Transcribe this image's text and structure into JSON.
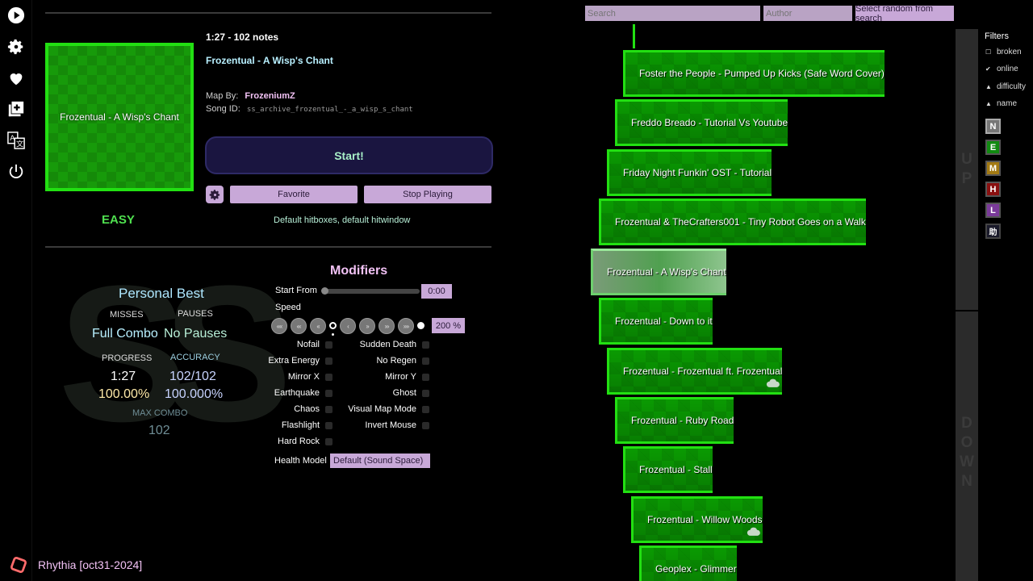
{
  "rail": {
    "icons": [
      "play-icon",
      "gear-icon",
      "heart-icon",
      "add-icon",
      "translate-icon",
      "power-icon"
    ]
  },
  "song": {
    "cover_text": "Frozentual - A Wisp's Chant",
    "length_notes": "1:27 - 102 notes",
    "title": "Frozentual - A Wisp's Chant",
    "map_by_label": "Map By:",
    "map_by": "FrozeniumZ",
    "song_id_label": "Song ID:",
    "song_id": "ss_archive_frozentual_-_a_wisp_s_chant",
    "difficulty": "EASY",
    "hitbox_text": "Default hitboxes, default hitwindow"
  },
  "actions": {
    "start": "Start!",
    "favorite": "Favorite",
    "stop_playing": "Stop Playing"
  },
  "personal_best": {
    "title": "Personal Best",
    "bg_letters": "SS",
    "misses_label": "MISSES",
    "misses": "Full Combo",
    "pauses_label": "PAUSES",
    "pauses": "No Pauses",
    "progress_label": "PROGRESS",
    "progress_time": "1:27",
    "progress_pct": "100.00%",
    "accuracy_label": "ACCURACY",
    "accuracy_hits": "102/102",
    "accuracy_pct": "100.000%",
    "max_combo_label": "MAX COMBO",
    "max_combo": "102"
  },
  "modifiers": {
    "title": "Modifiers",
    "start_from_label": "Start From",
    "start_from_value": "0:00",
    "speed_label": "Speed",
    "speed_value": "200 %",
    "speed_buttons": [
      "‹‹‹‹",
      "‹‹‹",
      "‹‹",
      "‹",
      "›",
      "››",
      "›››",
      "››››"
    ],
    "left": [
      "Nofail",
      "Extra Energy",
      "Mirror X",
      "Earthquake",
      "Chaos",
      "Flashlight",
      "Hard Rock"
    ],
    "right": [
      "Sudden Death",
      "No Regen",
      "Mirror Y",
      "Ghost",
      "Visual Map Mode",
      "Invert Mouse"
    ],
    "health_label": "Health Model",
    "health_value": "Default (Sound Space)"
  },
  "search": {
    "search_placeholder": "Search",
    "author_placeholder": "Author",
    "random_label": "Select random from search"
  },
  "songs": [
    "Foster the People - Pumped Up Kicks (Safe Word Cover)",
    "Freddo Breado - Tutorial Vs Youtube",
    "Friday Night Funkin' OST - Tutorial",
    "Frozentual & TheCrafters001 - Tiny Robot Goes on a Walk",
    "Frozentual - A Wisp's Chant",
    "Frozentual - Down to it",
    "Frozentual - Frozentual ft. Frozentual",
    "Frozentual - Ruby Road",
    "Frozentual - Stall",
    "Frozentual - Willow Woods",
    "Geoplex - Glimmer"
  ],
  "selected_song_index": 4,
  "scroll": {
    "up": [
      "U",
      "P"
    ],
    "down": [
      "D",
      "O",
      "W",
      "N"
    ]
  },
  "filters": {
    "title": "Filters",
    "items": [
      {
        "label": "broken",
        "mark": "☐"
      },
      {
        "label": "online",
        "mark": "✔"
      },
      {
        "label": "difficulty",
        "mark": "▲"
      },
      {
        "label": "name",
        "mark": "▲"
      }
    ],
    "difficulties": [
      {
        "label": "N",
        "color": "#777777"
      },
      {
        "label": "E",
        "color": "#118a11"
      },
      {
        "label": "M",
        "color": "#a37a14"
      },
      {
        "label": "H",
        "color": "#8a1010"
      },
      {
        "label": "L",
        "color": "#7a3a9a"
      },
      {
        "label": "助",
        "color": "#1a1a2a"
      }
    ]
  },
  "footer": {
    "version": "Rhythia [oct31-2024]"
  },
  "colors": {
    "accent_green": "#22e012",
    "button_lilac": "#c8a8d8",
    "title_pink": "#f2c2f5"
  }
}
